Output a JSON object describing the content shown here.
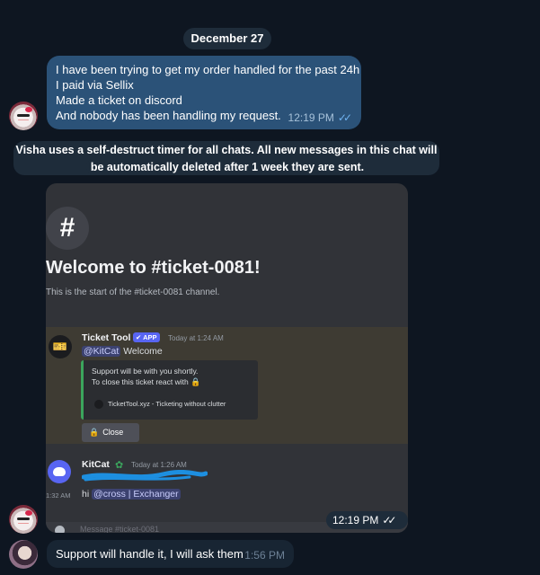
{
  "chat": {
    "date_separator": "December 27",
    "outgoing": {
      "lines": [
        "I have been trying to get my order handled for the past 24h",
        "I paid via Sellix",
        "Made a ticket on discord",
        "And nobody has been handling my request."
      ],
      "time": "12:19 PM",
      "status": "read"
    },
    "service_message": {
      "line1": "Visha uses a self-destruct timer for all chats. All new messages in this chat will",
      "line2": "be automatically deleted after 1 week they are sent."
    },
    "image_message": {
      "time": "12:19 PM",
      "status": "read"
    },
    "incoming": {
      "text": "Support will handle it, I will ask them",
      "time": "1:56 PM"
    }
  },
  "discord": {
    "channel_icon": "#",
    "welcome_title": "Welcome to #ticket-0081!",
    "welcome_subtitle": "This is the start of the #ticket-0081 channel.",
    "ticket_tool": {
      "name": "Ticket Tool",
      "badge": "✔ APP",
      "timestamp": "Today at 1:24 AM",
      "mention": "@KitCat",
      "text": "Welcome",
      "embed_line1": "Support will be with you shortly.",
      "embed_line2": "To close this ticket react with",
      "embed_footer": "TicketTool.xyz - Ticketing without clutter",
      "close_button": "Close"
    },
    "kitcat": {
      "name": "KitCat",
      "timestamp": "Today at 1:26 AM",
      "side_time": "1:32 AM",
      "text": "hi",
      "mention": "@cross | Exchanger"
    },
    "message_placeholder": "Message #ticket-0081"
  },
  "colors": {
    "chat_bg": "#0e1621",
    "outgoing_bubble": "#2b5278",
    "incoming_bubble": "#182533",
    "discord_bg": "#313338",
    "discord_blurple": "#5865f2"
  }
}
